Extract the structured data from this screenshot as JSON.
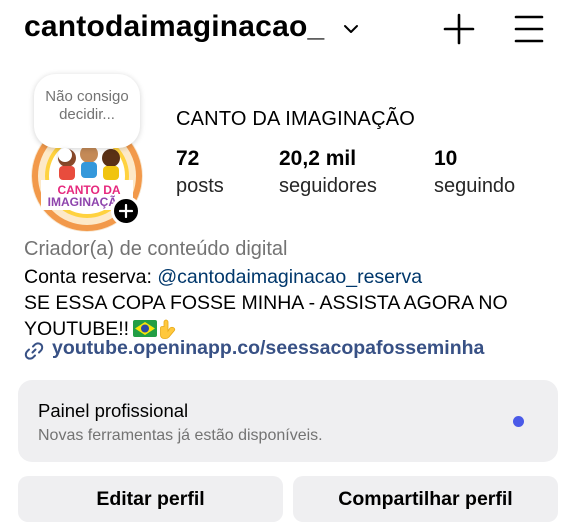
{
  "header": {
    "username": "cantodaimaginacao_",
    "chevron_icon": "chevron-down-icon",
    "create_icon": "plus-icon",
    "menu_icon": "hamburger-menu-icon"
  },
  "note": {
    "text": "Não consigo decidir..."
  },
  "profile": {
    "display_name": "CANTO DA IMAGINAÇÃO",
    "avatar_text": [
      "CANTO DA",
      "IMAGINAÇÃO"
    ],
    "stats": [
      {
        "value": "72",
        "label": "posts"
      },
      {
        "value": "20,2 mil",
        "label": "seguidores"
      },
      {
        "value": "10",
        "label": "seguindo"
      }
    ]
  },
  "bio": {
    "category": "Criador(a) de conteúdo digital",
    "line1_prefix": "Conta reserva: ",
    "mention": "@cantodaimaginacao_reserva",
    "line2": "SE ESSA COPA FOSSE MINHA - ASSISTA AGORA NO",
    "line3": "YOUTUBE!!",
    "emojis": [
      "flag-brazil",
      "pointing-down-hand"
    ],
    "link": "youtube.openinapp.co/seessacopafosseminha"
  },
  "professional_panel": {
    "title": "Painel profissional",
    "subtitle": "Novas ferramentas já estão disponíveis.",
    "dot_color": "#4a5ae8"
  },
  "buttons": {
    "edit": "Editar perfil",
    "share": "Compartilhar perfil"
  },
  "colors": {
    "mention": "#00376b",
    "link": "#385185",
    "secondary_text": "#737373",
    "panel_bg": "#efeff1"
  }
}
